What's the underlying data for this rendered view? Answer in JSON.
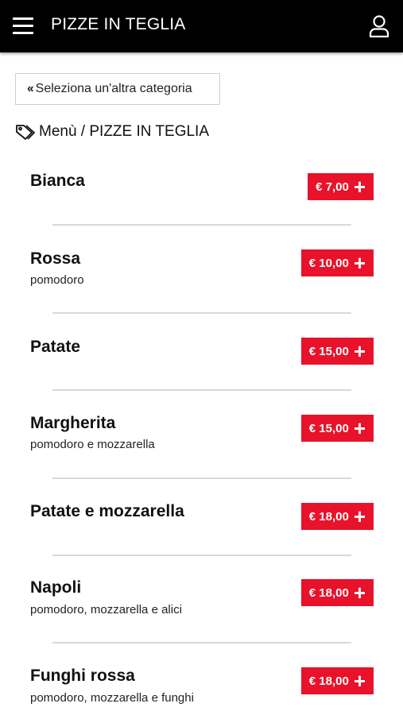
{
  "header": {
    "title": "PIZZE IN TEGLIA",
    "menu_icon": "hamburger-menu-icon",
    "user_icon": "user-icon",
    "background": "#000000"
  },
  "back_button": {
    "label": "Seleziona un'altra categoria",
    "icon": "double-chevron-left-icon"
  },
  "breadcrumb": {
    "icon": "tag-icon",
    "text": "Menù / PIZZE IN TEGLIA"
  },
  "accent_color": "#e8122a",
  "items": [
    {
      "name": "Bianca",
      "description": "",
      "price": "€ 7,00"
    },
    {
      "name": "Rossa",
      "description": "pomodoro",
      "price": "€ 10,00"
    },
    {
      "name": "Patate",
      "description": "",
      "price": "€ 15,00"
    },
    {
      "name": "Margherita",
      "description": "pomodoro e mozzarella",
      "price": "€ 15,00"
    },
    {
      "name": "Patate e mozzarella",
      "description": "",
      "price": "€ 18,00"
    },
    {
      "name": "Napoli",
      "description": "pomodoro, mozzarella e alici",
      "price": "€ 18,00"
    },
    {
      "name": "Funghi rossa",
      "description": "pomodoro, mozzarella e funghi",
      "price": "€ 18,00"
    }
  ]
}
